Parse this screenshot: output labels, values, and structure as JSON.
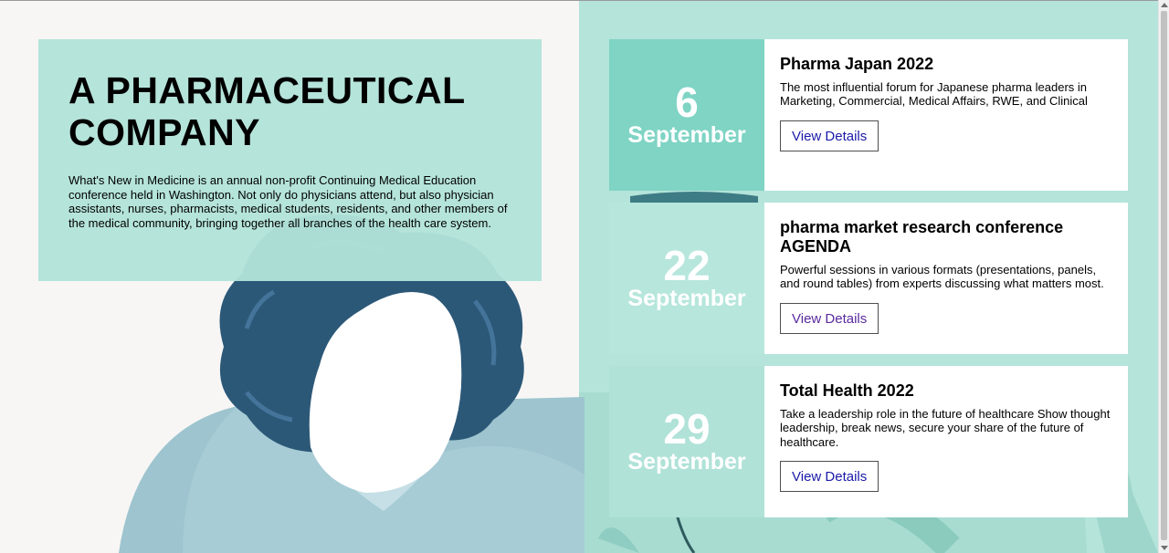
{
  "hero": {
    "title_line1": "A PHARMACEUTICAL",
    "title_line2": "COMPANY",
    "description": "What's New in Medicine is an annual non-profit Continuing Medical Education conference held in Washington. Not only do physicians attend, but also physician assistants, nurses, pharmacists, medical students, residents, and other members of the medical community, bringing together all branches of the health care system."
  },
  "events": [
    {
      "day": "6",
      "month": "September",
      "title": "Pharma Japan 2022",
      "description": "The most influential forum for Japanese pharma leaders in Marketing, Commercial, Medical Affairs, RWE, and Clinical",
      "button_label": "View Details"
    },
    {
      "day": "22",
      "month": "September",
      "title": "pharma market research conference AGENDA",
      "description": "Powerful sessions in various formats (presentations, panels, and round tables) from experts discussing what matters most.",
      "button_label": "View Details"
    },
    {
      "day": "29",
      "month": "September",
      "title": "Total Health 2022",
      "description": "Take a leadership role in the future of healthcare Show thought leadership, break news, secure your share of the future of healthcare.",
      "button_label": "View Details"
    }
  ],
  "colors": {
    "accent_teal": "#7fd4c4",
    "panel_mint": "#b4e4da",
    "hair_navy": "#2c5878",
    "link_blue": "#1a1aa8",
    "link_visited": "#5a2aa0"
  }
}
